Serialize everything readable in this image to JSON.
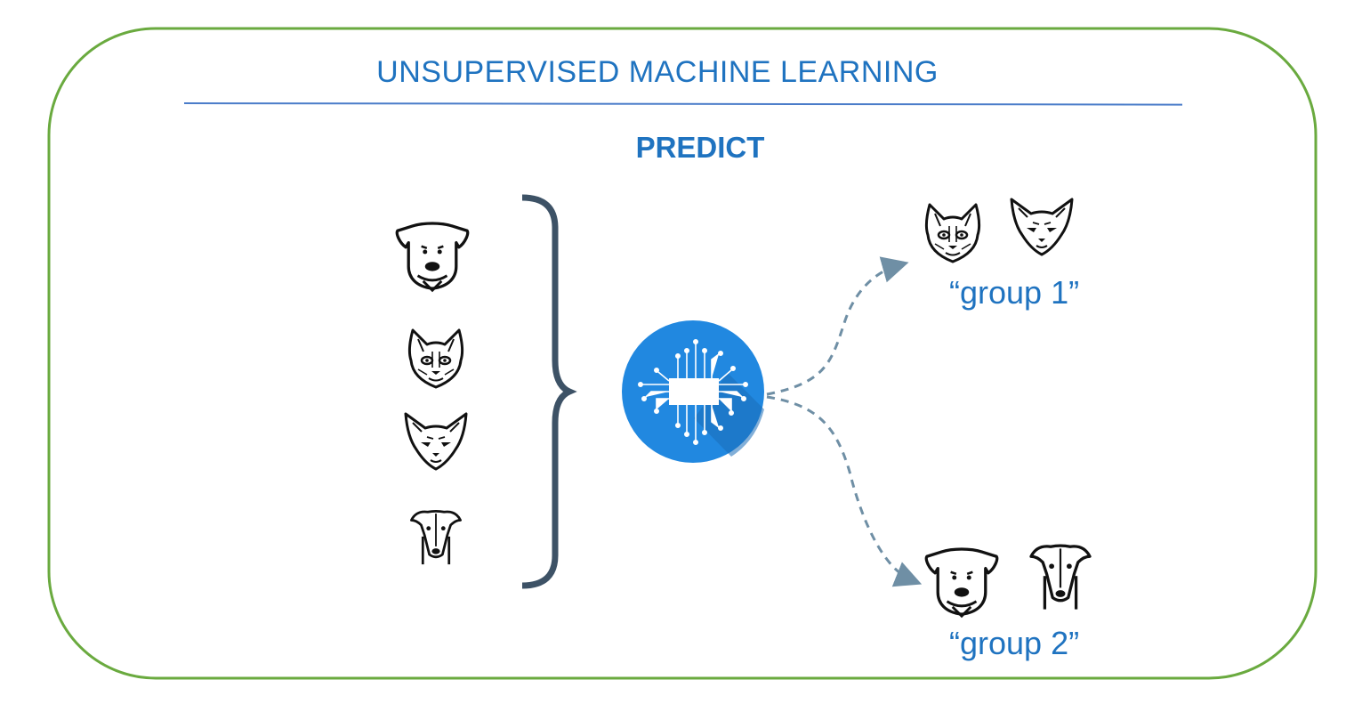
{
  "diagram": {
    "title": "UNSUPERVISED MACHINE LEARNING",
    "subtitle": "PREDICT",
    "inputs": [
      {
        "animal": "dog",
        "icon": "terrier-dog-icon"
      },
      {
        "animal": "cat",
        "icon": "sphynx-cat-icon"
      },
      {
        "animal": "cat",
        "icon": "siamese-cat-icon"
      },
      {
        "animal": "dog",
        "icon": "greyhound-dog-icon"
      }
    ],
    "model_icon": "circuit-chip-icon",
    "groups": [
      {
        "label": "“group 1”",
        "icons": [
          "sphynx-cat-icon",
          "siamese-cat-icon"
        ]
      },
      {
        "label": "“group 2”",
        "icons": [
          "terrier-dog-icon",
          "greyhound-dog-icon"
        ]
      }
    ]
  },
  "colors": {
    "accent": "#1f73c0",
    "frame": "#6aaa3f",
    "divider": "#4a7cc9",
    "brace": "#3d5266",
    "chip_circle": "#2188e0",
    "arrow": "#6f8fa5"
  }
}
